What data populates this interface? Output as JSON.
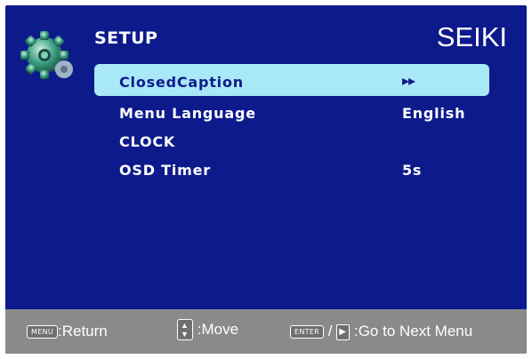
{
  "header": {
    "title": "SETUP",
    "brand": "SEIKI"
  },
  "menu": {
    "items": [
      {
        "label": "ClosedCaption",
        "value": "▸▸",
        "selected": true
      },
      {
        "label": "Menu Language",
        "value": "English"
      },
      {
        "label": "CLOCK",
        "value": ""
      },
      {
        "label": "OSD Timer",
        "value": "5s"
      }
    ]
  },
  "footer": {
    "menu_key": "MENU",
    "return_label": ":Return",
    "move_label": ":Move",
    "enter_key": "ENTER",
    "separator": "/",
    "next_label": ":Go to Next Menu"
  },
  "colors": {
    "screen_bg": "#0d1a8c",
    "highlight": "#a9e8f7",
    "footer_bg": "#8a8a8a"
  },
  "icons": [
    "gear-icon",
    "up-down-arrows-icon",
    "play-arrow-icon"
  ]
}
